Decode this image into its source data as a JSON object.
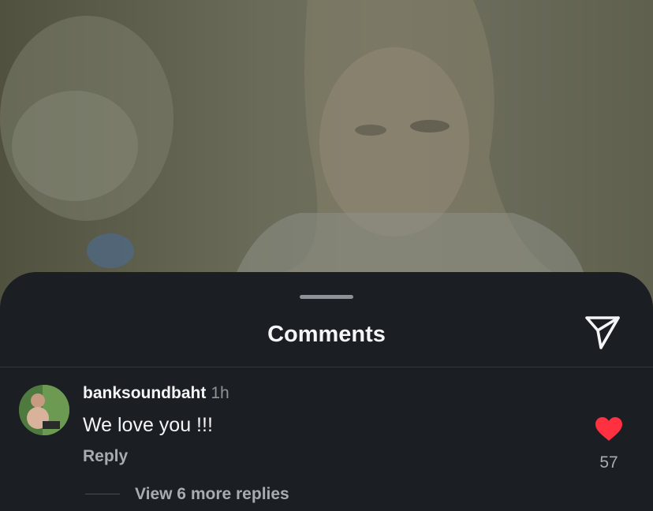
{
  "sheet": {
    "title": "Comments",
    "share_icon": "paper-plane-icon"
  },
  "comment": {
    "username": "banksoundbaht",
    "time": "1h",
    "text": "We love you !!!",
    "reply_label": "Reply",
    "like_icon": "heart-filled-icon",
    "liked": true,
    "like_count": "57",
    "view_replies_label": "View 6 more replies"
  },
  "colors": {
    "sheet_bg": "#1b1e22",
    "heart": "#ff3040",
    "text_primary": "#f3f5f7",
    "text_secondary": "#a8acb2"
  }
}
